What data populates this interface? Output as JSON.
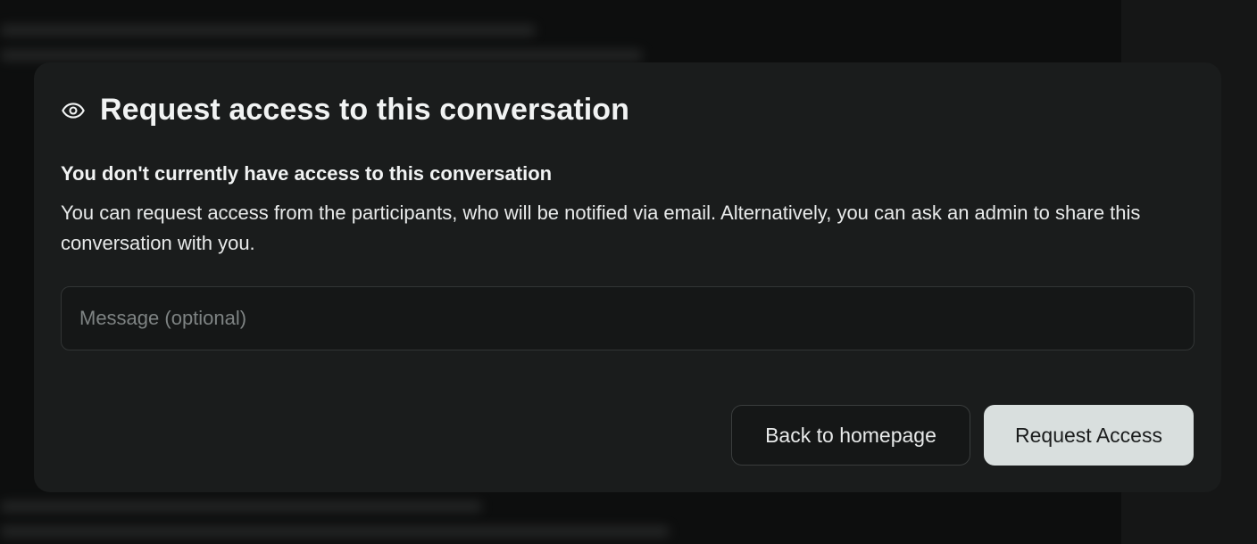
{
  "modal": {
    "title": "Request access to this conversation",
    "title_icon": "eye-icon",
    "subtitle": "You don't currently have access to this conversation",
    "description": "You can request access from the participants, who will be notified via email. Alternatively, you can ask an admin to share this conversation with you.",
    "message_input": {
      "value": "",
      "placeholder": "Message (optional)"
    },
    "buttons": {
      "back_label": "Back to homepage",
      "request_label": "Request Access"
    }
  },
  "colors": {
    "modal_background": "#1a1c1c",
    "primary_button": "#d9dfde",
    "text": "#f1f3f3"
  }
}
